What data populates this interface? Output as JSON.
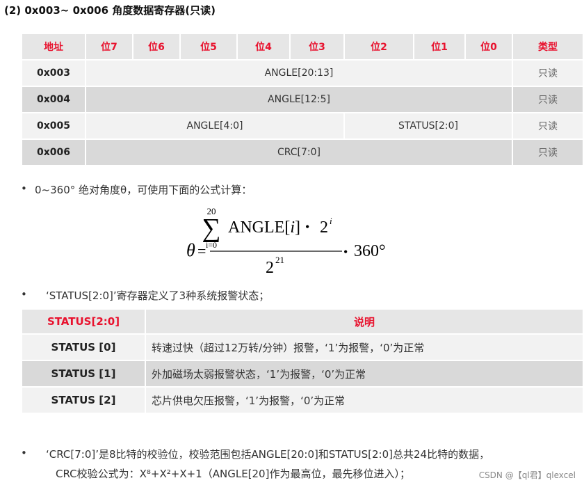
{
  "heading": "(2) 0x003~ 0x006 角度数据寄存器(只读)",
  "reg_table": {
    "headers": [
      "地址",
      "位7",
      "位6",
      "位5",
      "位4",
      "位3",
      "位2",
      "位1",
      "位0",
      "类型"
    ],
    "rows": [
      {
        "addr": "0x003",
        "field1": "ANGLE[20:13]",
        "type": "只读"
      },
      {
        "addr": "0x004",
        "field1": "ANGLE[12:5]",
        "type": "只读"
      },
      {
        "addr": "0x005",
        "field1": "ANGLE[4:0]",
        "field2": "STATUS[2:0]",
        "type": "只读"
      },
      {
        "addr": "0x006",
        "field1": "CRC[7:0]",
        "type": "只读"
      }
    ]
  },
  "bullets": {
    "b1": "0~360° 绝对角度θ，可使用下面的公式计算：",
    "b2": "‘STATUS[2:0]’寄存器定义了3种系统报警状态；",
    "b3_line1": "‘CRC[7:0]’是8比特的校验位，校验范围包括ANGLE[20:0]和STATUS[2:0]总共24比特的数据，",
    "b3_line2": "CRC校验公式为：X⁸+X²+X+1（ANGLE[20]作为最高位，最先移位进入）；",
    "dot": "•"
  },
  "formula": {
    "theta": "θ",
    "equals": "=",
    "sum_top": "20",
    "sum_sign": "∑",
    "sum_bottom": "i=0",
    "numerator_text": "ANGLE[",
    "index": "i",
    "numerator_close": "]",
    "bullet": "•",
    "two": "2",
    "exp_i": "i",
    "denominator_base": "2",
    "denominator_exp": "21",
    "times": "•",
    "degrees": "360°"
  },
  "status_table": {
    "headers": [
      "STATUS[2:0]",
      "说明"
    ],
    "rows": [
      {
        "name": "STATUS [0]",
        "desc": "转速过快（超过12万转/分钟）报警，‘1’为报警，‘0’为正常"
      },
      {
        "name": "STATUS [1]",
        "desc": "外加磁场太弱报警状态，‘1’为报警，‘0’为正常"
      },
      {
        "name": "STATUS [2]",
        "desc": "芯片供电欠压报警，‘1’为报警，‘0’为正常"
      }
    ]
  },
  "watermark": "CSDN @【ql君】qlexcel"
}
